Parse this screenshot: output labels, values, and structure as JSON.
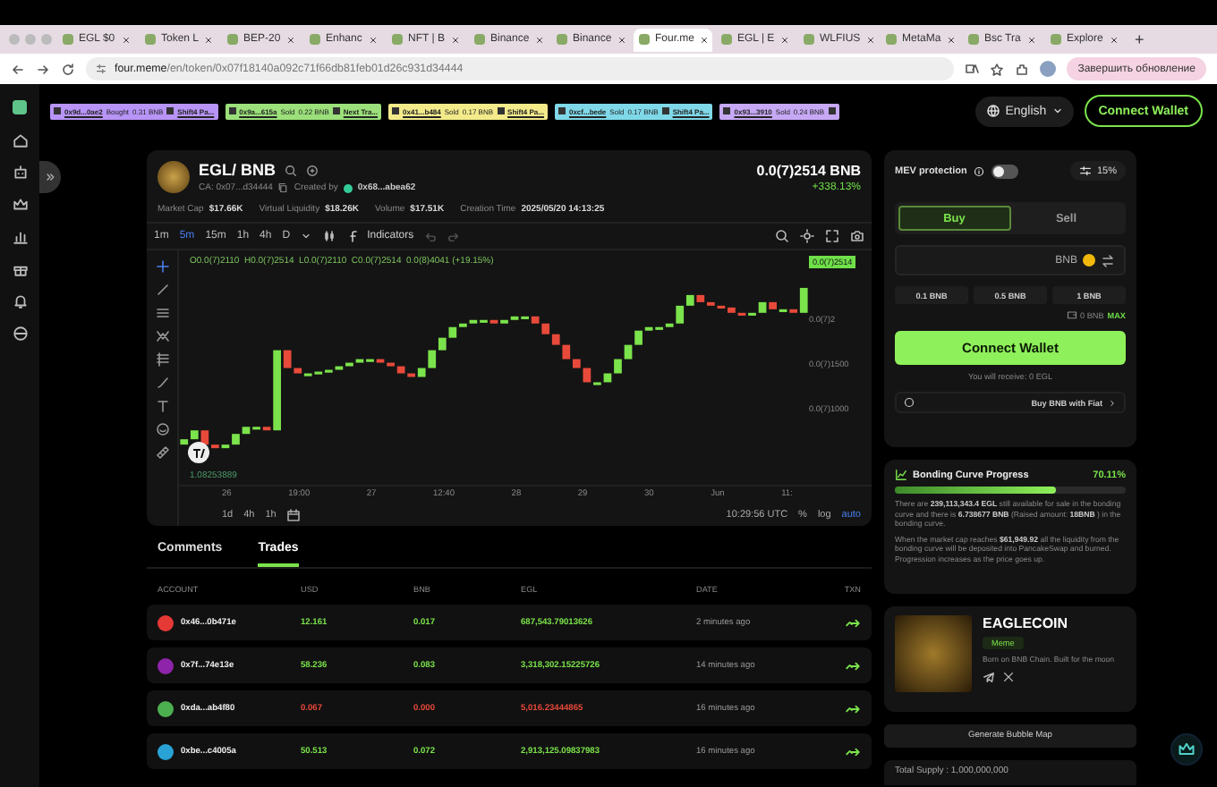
{
  "browser": {
    "tabs": [
      {
        "label": "EGL $0",
        "selected": false
      },
      {
        "label": "Token L",
        "selected": false
      },
      {
        "label": "BEP-20",
        "selected": false
      },
      {
        "label": "Enhanc",
        "selected": false
      },
      {
        "label": "NFT | B",
        "selected": false
      },
      {
        "label": "Binance",
        "selected": false
      },
      {
        "label": "Binance",
        "selected": false
      },
      {
        "label": "Four.me",
        "selected": true
      },
      {
        "label": "EGL | E",
        "selected": false
      },
      {
        "label": "WLFIUS",
        "selected": false
      },
      {
        "label": "MetaMa",
        "selected": false
      },
      {
        "label": "Bsc Tra",
        "selected": false
      },
      {
        "label": "Explore",
        "selected": false
      }
    ],
    "new_tab": "+",
    "url_host": "four.meme",
    "url_path": "/en/token/0x07f18140a092c71f66db81feb01d26c931d34444",
    "update_button": "Завершить обновление"
  },
  "ticker": [
    {
      "address": "0x9d...0ae2",
      "action": "Bought",
      "amount": "0.31 BNB",
      "label": "Shift4 Pa...",
      "color": "#b794f6"
    },
    {
      "address": "0x9a...615a",
      "action": "Sold",
      "amount": "0.22 BNB",
      "label": "Next Tra...",
      "color": "#9be07a"
    },
    {
      "address": "0x41...b484",
      "action": "Sold",
      "amount": "0.17 BNB",
      "label": "Shift4 Pa...",
      "color": "#f3ea8a"
    },
    {
      "address": "0xcf...bede",
      "action": "Sold",
      "amount": "0.17 BNB",
      "label": "Shift4 Pa...",
      "color": "#7fd8e8"
    },
    {
      "address": "0x93...3910",
      "action": "Sold",
      "amount": "0.24 BNB",
      "color": "#c6a8f5"
    }
  ],
  "language": "English",
  "connect_wallet": "Connect Wallet",
  "token": {
    "pair": "EGL/ BNB",
    "ca": "CA: 0x07...d34444",
    "created_by": "Created by",
    "creator": "0x68...abea62",
    "price": "0.0(7)2514 BNB",
    "change": "+338.13%",
    "stats": [
      {
        "label": "Market Cap",
        "value": "$17.66K"
      },
      {
        "label": "Virtual Liquidity",
        "value": "$18.26K"
      },
      {
        "label": "Volume",
        "value": "$17.51K"
      },
      {
        "label": "Creation Time",
        "value": "2025/05/20 14:13:25"
      }
    ]
  },
  "chart": {
    "timeframes": [
      {
        "label": "1m",
        "selected": false
      },
      {
        "label": "5m",
        "selected": true
      },
      {
        "label": "15m",
        "selected": false
      },
      {
        "label": "1h",
        "selected": false
      },
      {
        "label": "4h",
        "selected": false
      },
      {
        "label": "D",
        "selected": false
      }
    ],
    "indicators": "Indicators",
    "legend": "O0.0(7)2110  H0.0(7)2514  L0.0(7)2110  C0.0(7)2514  0.0(8)4041 (+19.15%)",
    "price_tag": "0.0(7)2514",
    "price_labels": [
      "0.0(7)2",
      "0.0(7)1500",
      "0.0(7)1000"
    ],
    "volume": "1.08253889",
    "time_labels": [
      "26",
      "19:00",
      "27",
      "12:40",
      "28",
      "29",
      "30",
      "Jun",
      "11:"
    ],
    "ranges": [
      "1d",
      "4h",
      "1h"
    ],
    "clock": "10:29:56 UTC",
    "percent": "%",
    "log": "log",
    "auto": "auto"
  },
  "activity": {
    "tabs": [
      {
        "label": "Comments",
        "selected": false
      },
      {
        "label": "Trades",
        "selected": true
      }
    ],
    "columns": [
      "ACCOUNT",
      "USD",
      "BNB",
      "EGL",
      "DATE",
      "TXN"
    ],
    "rows": [
      {
        "account": "0x46...0b471e",
        "usd": "12.161",
        "bnb": "0.017",
        "egl": "687,543.79013626",
        "date": "2 minutes ago",
        "kind": "buy",
        "color": "#e53935"
      },
      {
        "account": "0x7f...74e13e",
        "usd": "58.236",
        "bnb": "0.083",
        "egl": "3,318,302.15225726",
        "date": "14 minutes ago",
        "kind": "buy",
        "color": "#8e24aa"
      },
      {
        "account": "0xda...ab4f80",
        "usd": "0.067",
        "bnb": "0.000",
        "egl": "5,016.23444865",
        "date": "16 minutes ago",
        "kind": "sell",
        "color": "#4caf50"
      },
      {
        "account": "0xbe...c4005a",
        "usd": "50.513",
        "bnb": "0.072",
        "egl": "2,913,125.09837983",
        "date": "16 minutes ago",
        "kind": "buy",
        "color": "#29a3d6"
      }
    ]
  },
  "trade": {
    "mev_label": "MEV protection",
    "mev_on": false,
    "slippage": "15%",
    "sides": [
      {
        "label": "Buy",
        "selected": true
      },
      {
        "label": "Sell",
        "selected": false
      }
    ],
    "currency": "BNB",
    "presets": [
      "0.1 BNB",
      "0.5 BNB",
      "1 BNB"
    ],
    "balance": "0 BNB",
    "max": "MAX",
    "connect": "Connect Wallet",
    "receive": "You will receive: 0 EGL",
    "fiat": "Buy BNB with Fiat"
  },
  "bonding": {
    "title": "Bonding Curve Progress",
    "percent": "70.11%",
    "level": 0.7011,
    "paragraphs": [
      "There are **239,113,343.4 EGL** still available for sale in the bonding curve and there is **6.738677 BNB** (Raised amount: **18BNB** ) in the bonding curve.",
      "When the market cap reaches **$61,949.92** all the liquidity from the bonding curve will be deposited into PancakeSwap and burned. Progression increases as the price goes up."
    ]
  },
  "coin": {
    "name": "EAGLECOIN",
    "tag": "Meme",
    "description": "Born on BNB Chain. Built for the moon"
  },
  "bubble_map": "Generate Bubble Map",
  "total_supply": "Total Supply : 1,000,000,000"
}
